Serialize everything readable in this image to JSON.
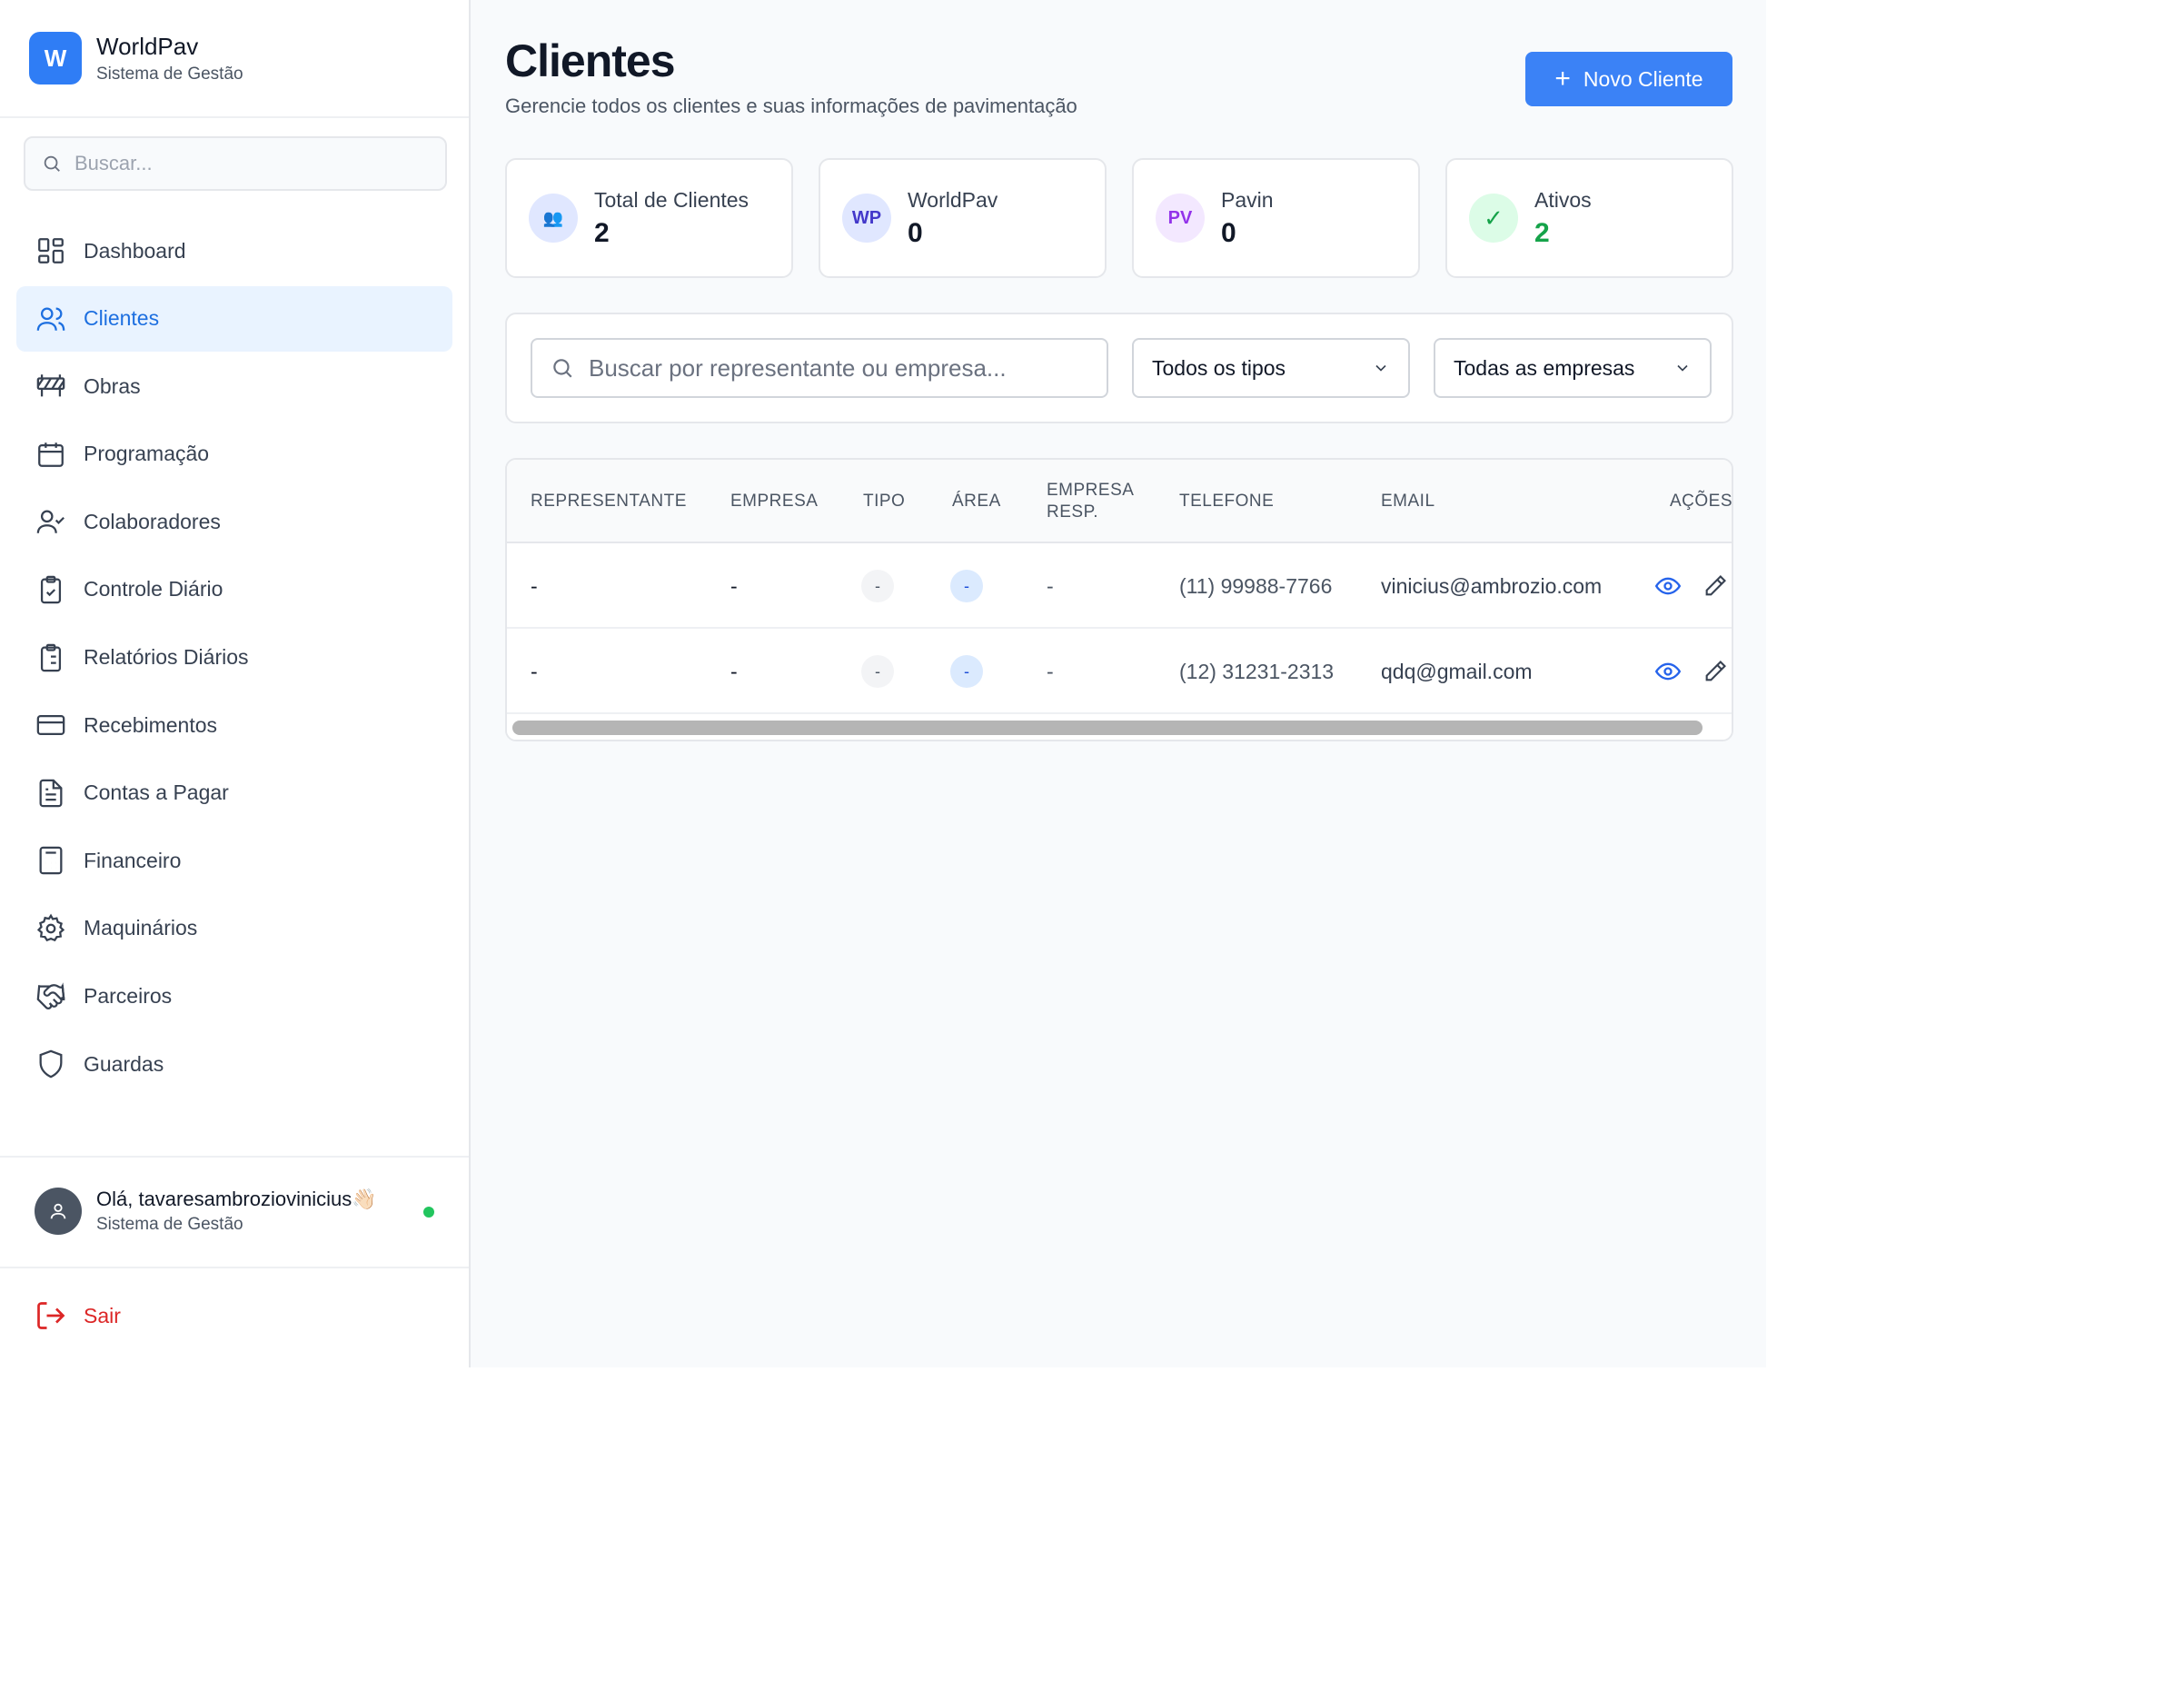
{
  "brand": {
    "logo_letter": "W",
    "name": "WorldPav",
    "subtitle": "Sistema de Gestão",
    "accent": "#2f7df5"
  },
  "sidebar": {
    "search_placeholder": "Buscar...",
    "items": [
      {
        "label": "Dashboard",
        "icon": "dashboard-icon",
        "active": false
      },
      {
        "label": "Clientes",
        "icon": "users-icon",
        "active": true
      },
      {
        "label": "Obras",
        "icon": "construction-barrier-icon",
        "active": false
      },
      {
        "label": "Programação",
        "icon": "calendar-icon",
        "active": false
      },
      {
        "label": "Colaboradores",
        "icon": "user-check-icon",
        "active": false
      },
      {
        "label": "Controle Diário",
        "icon": "clipboard-check-icon",
        "active": false
      },
      {
        "label": "Relatórios Diários",
        "icon": "clipboard-list-icon",
        "active": false
      },
      {
        "label": "Recebimentos",
        "icon": "credit-card-icon",
        "active": false
      },
      {
        "label": "Contas a Pagar",
        "icon": "file-text-icon",
        "active": false
      },
      {
        "label": "Financeiro",
        "icon": "calculator-icon",
        "active": false
      },
      {
        "label": "Maquinários",
        "icon": "gear-icon",
        "active": false
      },
      {
        "label": "Parceiros",
        "icon": "handshake-icon",
        "active": false
      },
      {
        "label": "Guardas",
        "icon": "shield-icon",
        "active": false
      }
    ],
    "user": {
      "greeting": "Olá, tavaresambroziovinicius👋🏻",
      "subtitle": "Sistema de Gestão",
      "status_color": "#22c55e"
    },
    "logout_label": "Sair"
  },
  "main": {
    "title": "Clientes",
    "subtitle": "Gerencie todos os clientes e suas informações de pavimentação",
    "new_button_label": "Novo Cliente",
    "stats": [
      {
        "icon_text": "👥",
        "label": "Total de Clientes",
        "value": "2",
        "icon_bg": "#e0e7ff",
        "value_color": "#111827"
      },
      {
        "icon_text": "WP",
        "label": "WorldPav",
        "value": "0",
        "icon_bg": "#e0e7ff",
        "icon_color": "#4338ca",
        "value_color": "#111827"
      },
      {
        "icon_text": "PV",
        "label": "Pavin",
        "value": "0",
        "icon_bg": "#f3e8ff",
        "icon_color": "#9333ea",
        "value_color": "#111827"
      },
      {
        "icon_text": "✓",
        "label": "Ativos",
        "value": "2",
        "icon_bg": "#dcfce7",
        "icon_color": "#16a34a",
        "value_color": "#16a34a"
      }
    ],
    "filters": {
      "search_placeholder": "Buscar por representante ou empresa...",
      "type_select": "Todos os tipos",
      "company_select": "Todas as empresas"
    },
    "table": {
      "headers": [
        "REPRESENTANTE",
        "EMPRESA",
        "TIPO",
        "ÁREA",
        "EMPRESA RESP.",
        "TELEFONE",
        "EMAIL",
        "AÇÕES"
      ],
      "rows": [
        {
          "representante": "-",
          "empresa": "-",
          "tipo": "-",
          "area": "-",
          "empresa_resp": "-",
          "telefone": "(11) 99988-7766",
          "email": "vinicius@ambrozio.com"
        },
        {
          "representante": "-",
          "empresa": "-",
          "tipo": "-",
          "area": "-",
          "empresa_resp": "-",
          "telefone": "(12) 31231-2313",
          "email": "qdq@gmail.com"
        }
      ]
    }
  }
}
